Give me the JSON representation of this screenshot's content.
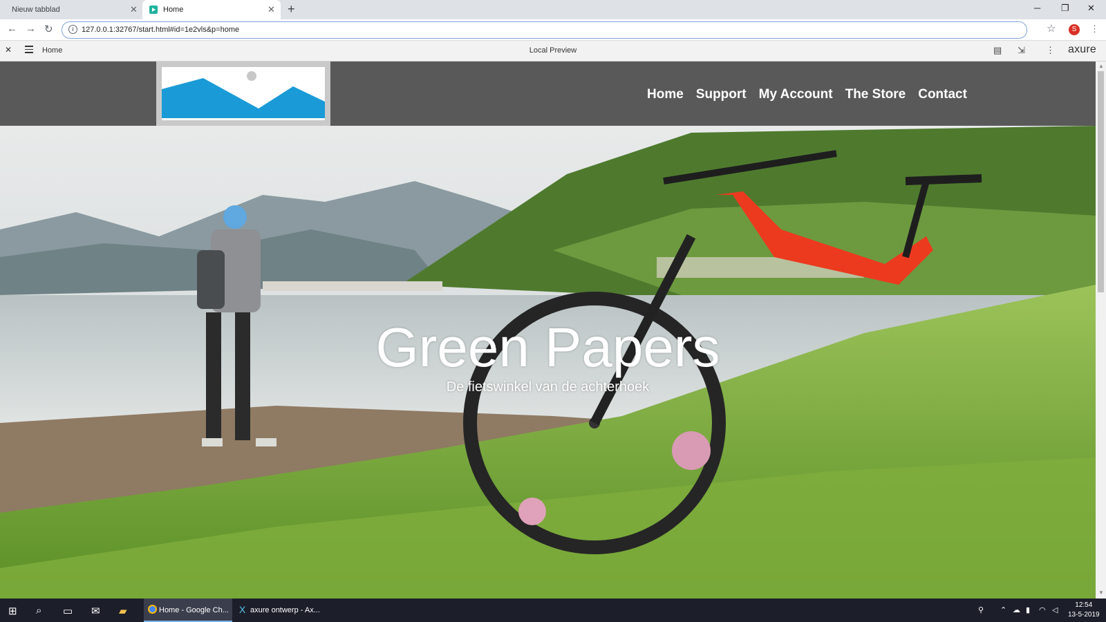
{
  "browser": {
    "tabs": [
      {
        "title": "Nieuw tabblad"
      },
      {
        "title": "Home"
      }
    ],
    "url": "127.0.0.1:32767/start.html#id=1e2vls&p=home",
    "profile_initial": "S"
  },
  "axure": {
    "page_name": "Home",
    "preview_label": "Local Preview",
    "logo": "axure"
  },
  "site": {
    "nav": [
      "Home",
      "Support",
      "My Account",
      "The Store",
      "Contact"
    ],
    "hero_title": "Green Papers",
    "hero_subtitle": "De fietswinkel van de achterhoek"
  },
  "taskbar": {
    "apps": [
      {
        "label": "Home - Google Ch..."
      },
      {
        "label": "axure ontwerp - Ax..."
      }
    ],
    "time": "12:54",
    "date": "13-5-2019"
  },
  "colors": {
    "header_bg": "#595959",
    "logo_blue": "#1a9bd7",
    "taskbar_bg": "#1c1f2a"
  }
}
